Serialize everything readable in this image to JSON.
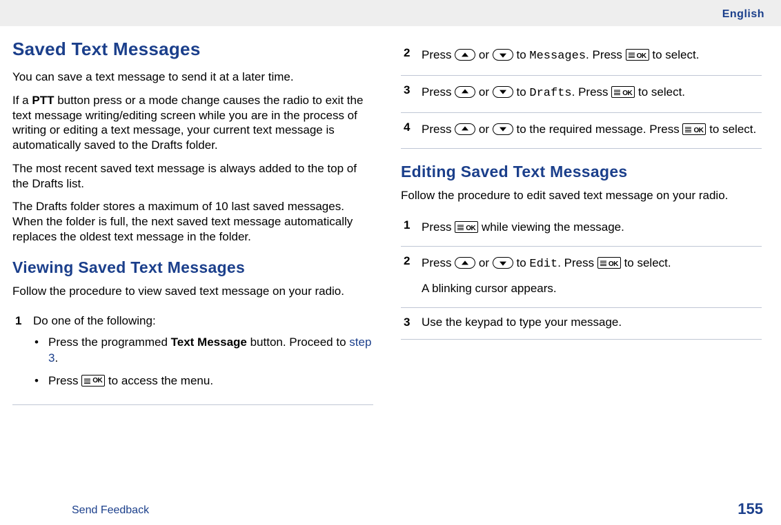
{
  "header": {
    "language": "English"
  },
  "left": {
    "h1": "Saved Text Messages",
    "p1": "You can save a text message to send it at a later time.",
    "p2a": "If a ",
    "p2b": "PTT",
    "p2c": " button press or a mode change causes the radio to exit the text message writing/editing screen while you are in the process of writing or editing a text message, your current text message is automatically saved to the Drafts folder.",
    "p3": "The most recent saved text message is always added to the top of the Drafts list.",
    "p4": "The Drafts folder stores a maximum of 10 last saved messages. When the folder is full, the next saved text message automatically replaces the oldest text message in the folder.",
    "h2": "Viewing Saved Text Messages",
    "p5": "Follow the procedure to view saved text message on your radio.",
    "step1": {
      "num": "1",
      "lead": "Do one of the following:",
      "b1a": "Press the programmed ",
      "b1b": "Text Message",
      "b1c": " button. Proceed to ",
      "b1d": "step 3",
      "b1e": ".",
      "b2a": "Press ",
      "b2b": " to access the menu."
    }
  },
  "right": {
    "step2": {
      "num": "2",
      "a": "Press ",
      "or": " or ",
      "to": " to ",
      "targ": "Messages",
      "dot": ". Press ",
      "tosel": " to select."
    },
    "step3": {
      "num": "3",
      "a": "Press ",
      "or": " or ",
      "to": " to ",
      "targ": "Drafts",
      "dot": ". Press ",
      "tosel": " to select."
    },
    "step4": {
      "num": "4",
      "a": "Press ",
      "or": " or ",
      "to": " to the required message. Press ",
      "tosel": " to select."
    },
    "h2": "Editing Saved Text Messages",
    "p": "Follow the procedure to edit saved text message on your radio.",
    "e1": {
      "num": "1",
      "a": "Press ",
      "b": " while viewing the message."
    },
    "e2": {
      "num": "2",
      "a": "Press ",
      "or": " or ",
      "to": " to ",
      "targ": "Edit",
      "dot": ". Press ",
      "tosel": " to select.",
      "extra": "A blinking cursor appears."
    },
    "e3": {
      "num": "3",
      "txt": "Use the keypad to type your message."
    }
  },
  "footer": {
    "feedback": "Send Feedback",
    "page": "155"
  }
}
